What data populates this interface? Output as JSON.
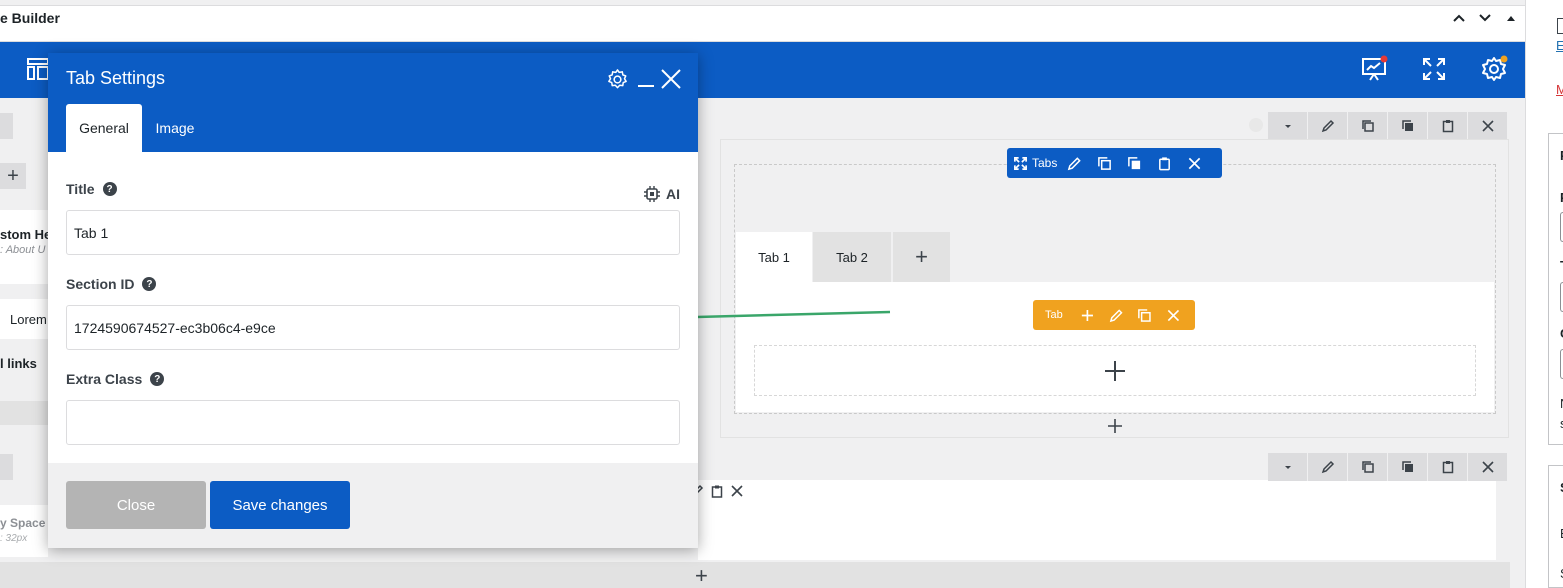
{
  "metabox": {
    "title": "e Builder"
  },
  "left_panel": {
    "custom_header_title": "stom He",
    "custom_header_sub": ": About U",
    "lorem_text": "Lorem",
    "links_text": "l links",
    "spacer_title": "y Space",
    "spacer_sub": ": 32px"
  },
  "right_sidebar": {
    "link1": "E",
    "link2": "M",
    "p": "P",
    "t": "T",
    "c": "C",
    "n": "N",
    "s1": "s",
    "s2": "S",
    "e": "E",
    "s3": "S"
  },
  "modal": {
    "title": "Tab Settings",
    "tabs": [
      {
        "label": "General"
      },
      {
        "label": "Image"
      }
    ],
    "ai_label": "AI",
    "fields": {
      "title": {
        "label": "Title",
        "value": "Tab 1"
      },
      "section_id": {
        "label": "Section ID",
        "value": "1724590674527-ec3b06c4-e9ce"
      },
      "extra_class": {
        "label": "Extra Class",
        "value": ""
      }
    },
    "close_label": "Close",
    "save_label": "Save changes"
  },
  "tabs_element": {
    "toolbar_label": "Tabs",
    "tab_toolbar_label": "Tab",
    "tabs": [
      {
        "label": "Tab 1"
      },
      {
        "label": "Tab 2"
      }
    ],
    "add_label": "+"
  },
  "colors": {
    "brand": "#0c5cc4",
    "tab_accent": "#f0a21f",
    "annotation_arrow": "#3aa66a"
  }
}
